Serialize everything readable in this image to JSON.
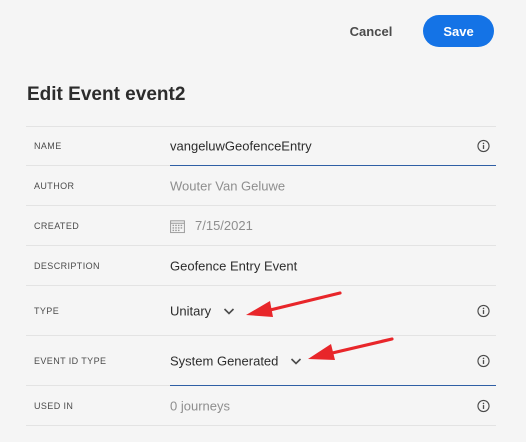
{
  "header": {
    "cancel_label": "Cancel",
    "save_label": "Save"
  },
  "title": "Edit Event event2",
  "fields": {
    "name": {
      "label": "NAME",
      "value": "vangeluwGeofenceEntry"
    },
    "author": {
      "label": "AUTHOR",
      "value": "Wouter Van Geluwe"
    },
    "created": {
      "label": "CREATED",
      "value": "7/15/2021"
    },
    "description": {
      "label": "DESCRIPTION",
      "value": "Geofence Entry Event"
    },
    "type": {
      "label": "TYPE",
      "value": "Unitary"
    },
    "event_id_type": {
      "label": "EVENT ID TYPE",
      "value": "System Generated"
    },
    "used_in": {
      "label": "USED IN",
      "value": "0 journeys"
    }
  },
  "colors": {
    "accent": "#1473e6",
    "arrow": "#e8262a"
  },
  "icons": [
    "info-icon",
    "calendar-icon",
    "chevron-down-icon",
    "red-arrow"
  ]
}
